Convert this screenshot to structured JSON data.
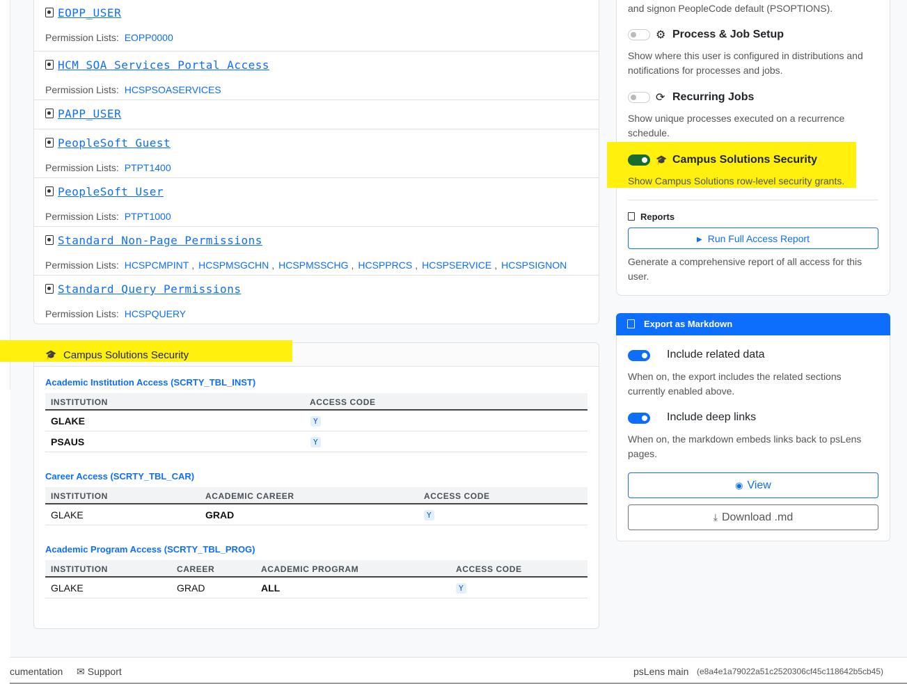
{
  "roles": [
    {
      "name": "EOPP_USER",
      "permission_label": "Permission Lists:",
      "lists": [
        "EOPP0000"
      ]
    },
    {
      "name": "HCM SOA Services Portal Access",
      "permission_label": "Permission Lists:",
      "lists": [
        "HCSPSOASERVICES"
      ]
    },
    {
      "name": "PAPP_USER",
      "permission_label": "",
      "lists": []
    },
    {
      "name": "PeopleSoft Guest",
      "permission_label": "Permission Lists:",
      "lists": [
        "PTPT1400"
      ]
    },
    {
      "name": "PeopleSoft User",
      "permission_label": "Permission Lists:",
      "lists": [
        "PTPT1000"
      ]
    },
    {
      "name": "Standard Non-Page Permissions",
      "permission_label": "Permission Lists:",
      "lists": [
        "HCSPCMPINT",
        "HCSPMSGCHN",
        "HCSPMSSCHG",
        "HCSPPRCS",
        "HCSPSERVICE",
        "HCSPSIGNON"
      ]
    },
    {
      "name": "Standard Query Permissions",
      "permission_label": "Permission Lists:",
      "lists": [
        "HCSPQUERY"
      ]
    }
  ],
  "campus": {
    "title": "Campus Solutions Security",
    "inst": {
      "title": "Academic Institution Access (SCRTY_TBL_INST)",
      "headers": [
        "INSTITUTION",
        "ACCESS CODE"
      ],
      "rows": [
        [
          "GLAKE",
          "Y"
        ],
        [
          "PSAUS",
          "Y"
        ]
      ]
    },
    "car": {
      "title": "Career Access (SCRTY_TBL_CAR)",
      "headers": [
        "INSTITUTION",
        "ACADEMIC CAREER",
        "ACCESS CODE"
      ],
      "rows": [
        [
          "GLAKE",
          "GRAD",
          "Y"
        ]
      ]
    },
    "prog": {
      "title": "Academic Program Access (SCRTY_TBL_PROG)",
      "headers": [
        "INSTITUTION",
        "CAREER",
        "ACADEMIC PROGRAM",
        "ACCESS CODE"
      ],
      "rows": [
        [
          "GLAKE",
          "GRAD",
          "ALL",
          "Y"
        ]
      ]
    }
  },
  "options": {
    "top_desc": "and signon PeopleCode default (PSOPTIONS).",
    "items": [
      {
        "label": "Process & Job Setup",
        "icon": "gear-icon",
        "enabled": false,
        "desc": "Show where this user is configured in distributions and notifications for processes and jobs."
      },
      {
        "label": "Recurring Jobs",
        "icon": "refresh-icon",
        "enabled": false,
        "desc": "Show unique processes executed on a recurrence schedule."
      },
      {
        "label": "Campus Solutions Security",
        "icon": "graduation-cap-icon",
        "enabled": true,
        "desc": "Show Campus Solutions row-level security grants."
      }
    ],
    "reports_heading": "Reports",
    "run_report_label": "Run Full Access Report",
    "reports_desc": "Generate a comprehensive report of all access for this user."
  },
  "export": {
    "title": "Export as Markdown",
    "related_label": "Include related data",
    "related_desc": "When on, the export includes the related sections currently enabled above.",
    "deeplinks_label": "Include deep links",
    "deeplinks_desc": "When on, the markdown embeds links back to psLens pages.",
    "view_label": "View",
    "download_label": "Download .md"
  },
  "footer": {
    "documentation": "cumentation",
    "support": "Support",
    "app_name": "psLens main",
    "version": "(e8a4e1a79022a51c2520306cf45c118642b5cb45)"
  },
  "colors": {
    "accent": "#0d6efd",
    "highlight": "#ffef00",
    "toggle_on": "#1a6b2e"
  }
}
